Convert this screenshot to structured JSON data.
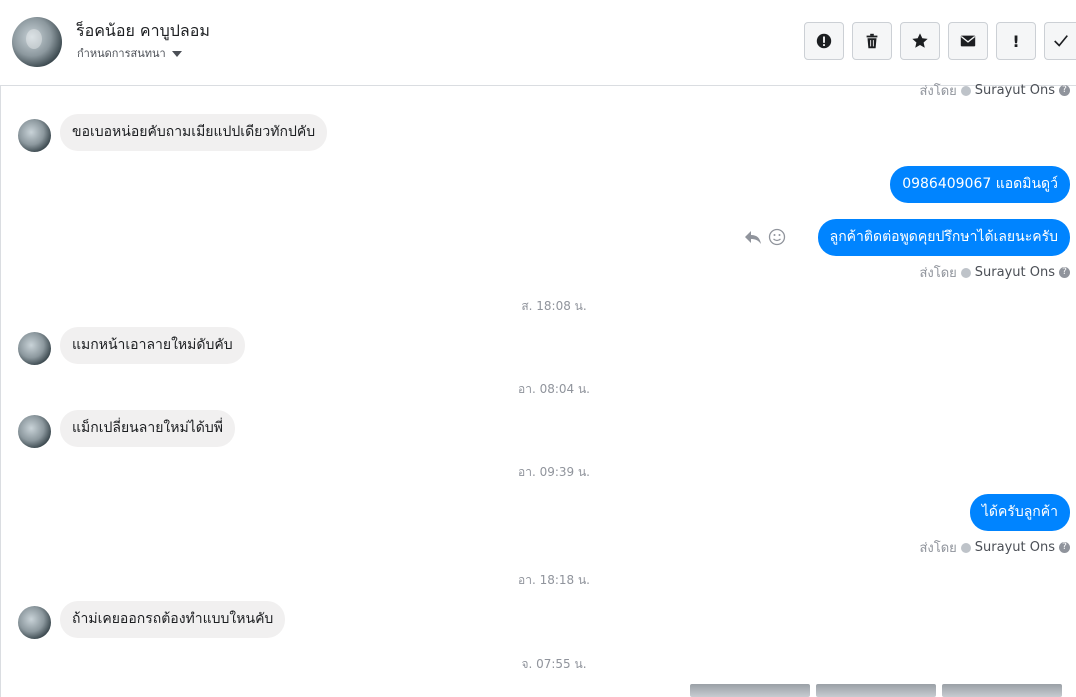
{
  "header": {
    "contact_name": "ร็อคน้อย คาบูปลอม",
    "contact_sub": "กำหนดการสนทนา"
  },
  "toolbar": {
    "buttons": [
      {
        "icon": "alert-circle-icon"
      },
      {
        "icon": "trash-icon"
      },
      {
        "icon": "star-icon"
      },
      {
        "icon": "envelope-icon"
      },
      {
        "icon": "exclamation-icon",
        "glyph": "!"
      },
      {
        "icon": "checkmark-icon"
      }
    ]
  },
  "messages": {
    "top_sent_by": {
      "label": "ส่งโดย",
      "name": "Surayut Ons"
    },
    "m1": "ขอเบอหน่อยคับถามเมียแปปเดียวทักปคับ",
    "m2": "0986409067 แอดมินดูว์",
    "m3": "ลูกค้าติดต่อพูดคุยปรึกษาได้เลยนะครับ",
    "m3_sent_by": {
      "label": "ส่งโดย",
      "name": "Surayut Ons"
    },
    "t1": "ส. 18:08 น.",
    "m4": "แมกหน้าเอาลายใหม่ดับคับ",
    "t2": "อา. 08:04 น.",
    "m5": "แม็กเปลี่ยนลายใหม่ได้บพี่",
    "t3": "อา. 09:39 น.",
    "m6": "ได้ครับลูกค้า",
    "m6_sent_by": {
      "label": "ส่งโดย",
      "name": "Surayut Ons"
    },
    "t4": "อา. 18:18 น.",
    "m7": "ถ้าม่เคยออกรถต้องทำแบบใหนคับ",
    "t5": "จ. 07:55 น."
  }
}
